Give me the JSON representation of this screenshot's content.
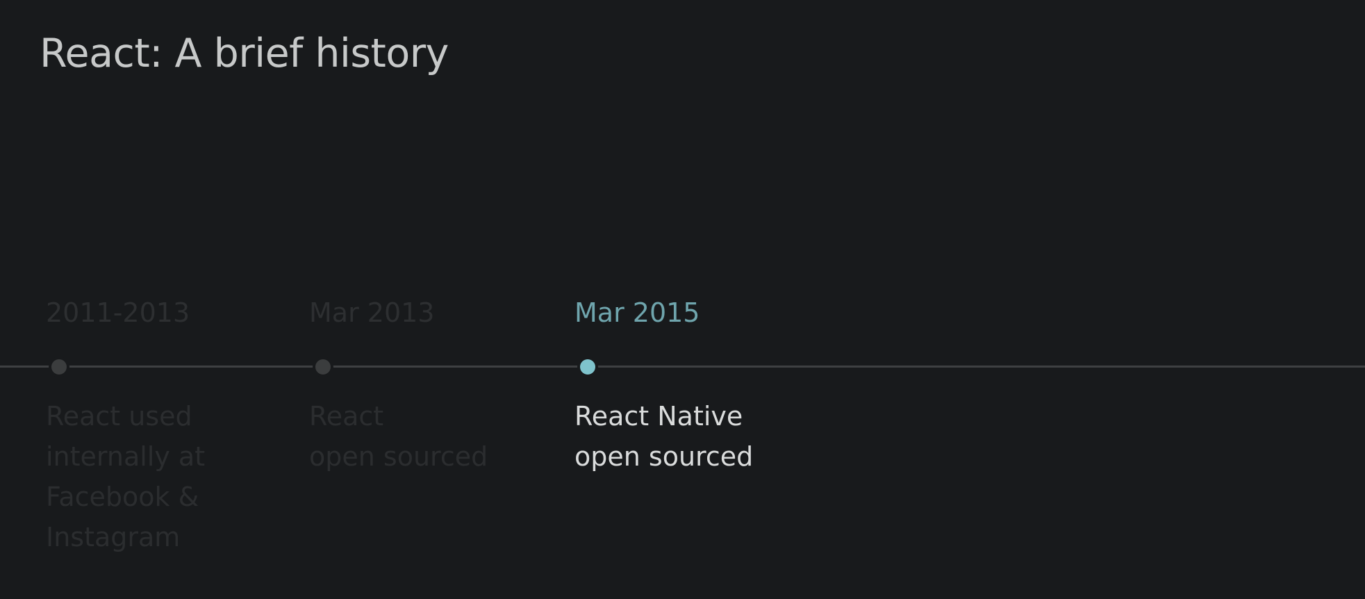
{
  "slide": {
    "title": "React: A brief history"
  },
  "timeline": {
    "events": [
      {
        "date": "2011-2013",
        "description_lines": [
          "React used",
          "internally at",
          "Facebook &",
          "Instagram"
        ],
        "state": "dimmed"
      },
      {
        "date": "Mar 2013",
        "description_lines": [
          "React",
          "open sourced"
        ],
        "state": "dimmed"
      },
      {
        "date": "Mar 2015",
        "description_lines": [
          "React Native",
          "open sourced"
        ],
        "state": "active"
      }
    ]
  },
  "colors": {
    "background": "#181a1c",
    "title": "#c7c9c9",
    "timeline_line": "#3e4042",
    "dimmed_text": "#2d2f31",
    "active_date": "#6fa5ad",
    "active_dot": "#7fc3cc",
    "active_text": "#dadcdc"
  }
}
